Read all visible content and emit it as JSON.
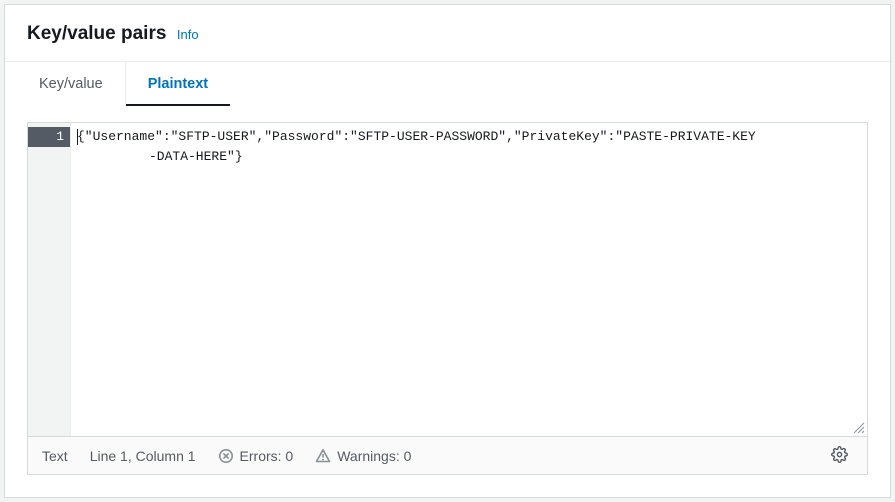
{
  "header": {
    "title": "Key/value pairs",
    "info_label": "Info"
  },
  "tabs": {
    "keyvalue": "Key/value",
    "plaintext": "Plaintext",
    "active": "plaintext"
  },
  "editor": {
    "line_number": "1",
    "content_line1": "{\"Username\":\"SFTP-USER\",\"Password\":\"SFTP-USER-PASSWORD\",\"PrivateKey\":\"PASTE-PRIVATE-KEY",
    "content_line2": "-DATA-HERE\"}"
  },
  "statusbar": {
    "mode": "Text",
    "position": "Line 1, Column 1",
    "errors_label": "Errors: 0",
    "warnings_label": "Warnings: 0"
  }
}
